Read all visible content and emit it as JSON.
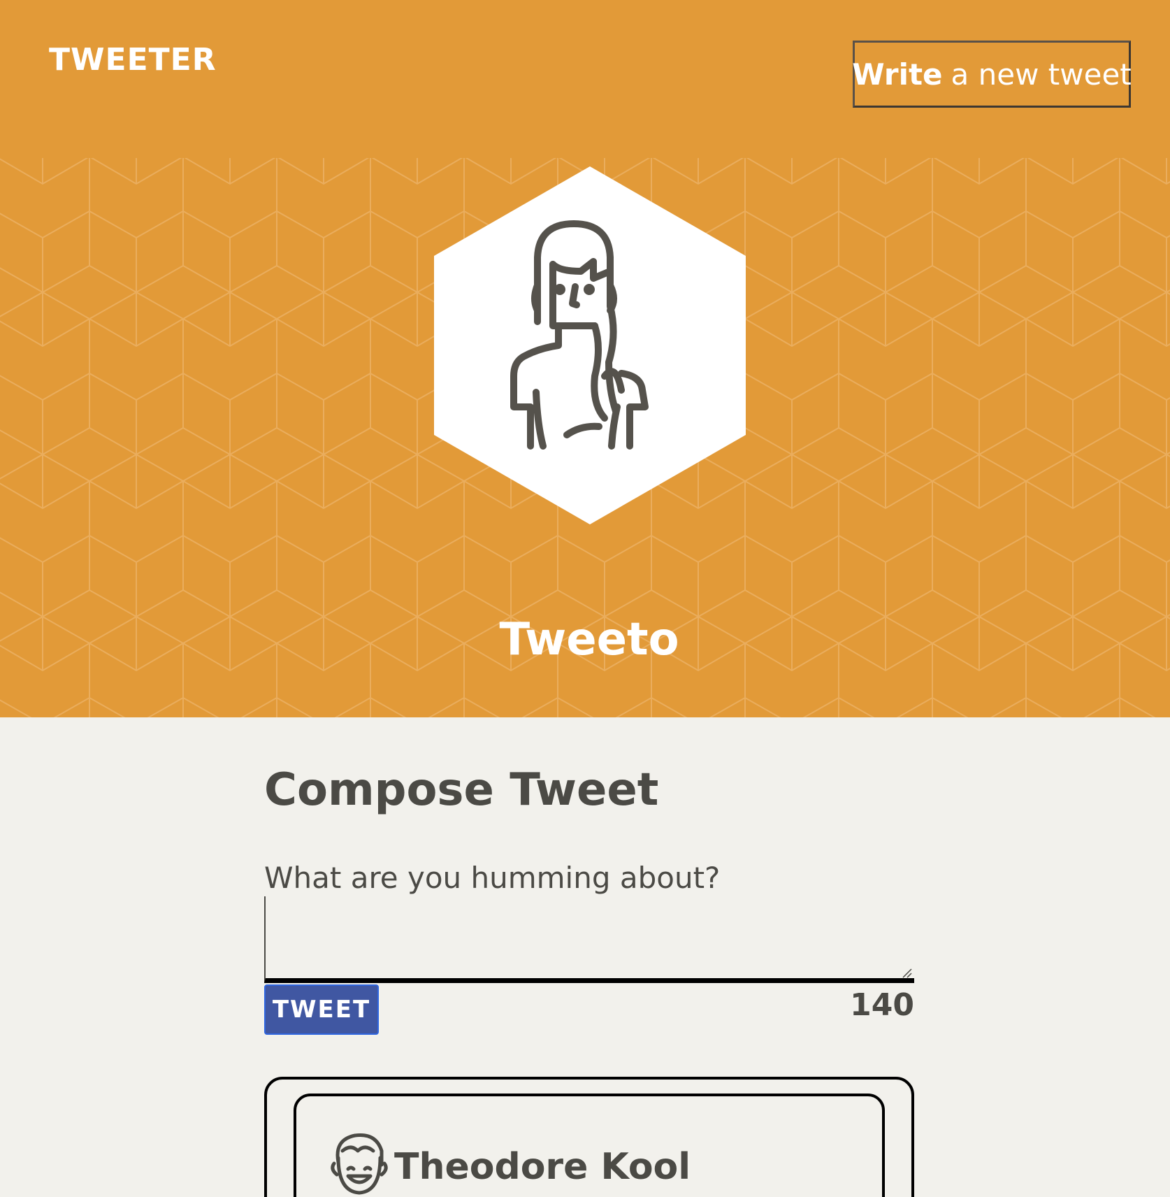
{
  "nav": {
    "logo": "TWEETER",
    "write_bold": "Write",
    "write_rest": "a new tweet"
  },
  "profile": {
    "name": "Tweeto",
    "avatar_icon": "woman-avatar-icon"
  },
  "compose": {
    "title": "Compose Tweet",
    "label": "What are you humming about?",
    "text_value": "",
    "button_label": "TWEET",
    "counter": "140"
  },
  "tweets": [
    {
      "author": "Theodore Kool",
      "avatar_icon": "man-avatar-icon"
    }
  ],
  "colors": {
    "header_bg": "#e29a38",
    "page_bg": "#f2f1ec",
    "tweet_button": "#4057a2",
    "text": "#4b4a45"
  }
}
